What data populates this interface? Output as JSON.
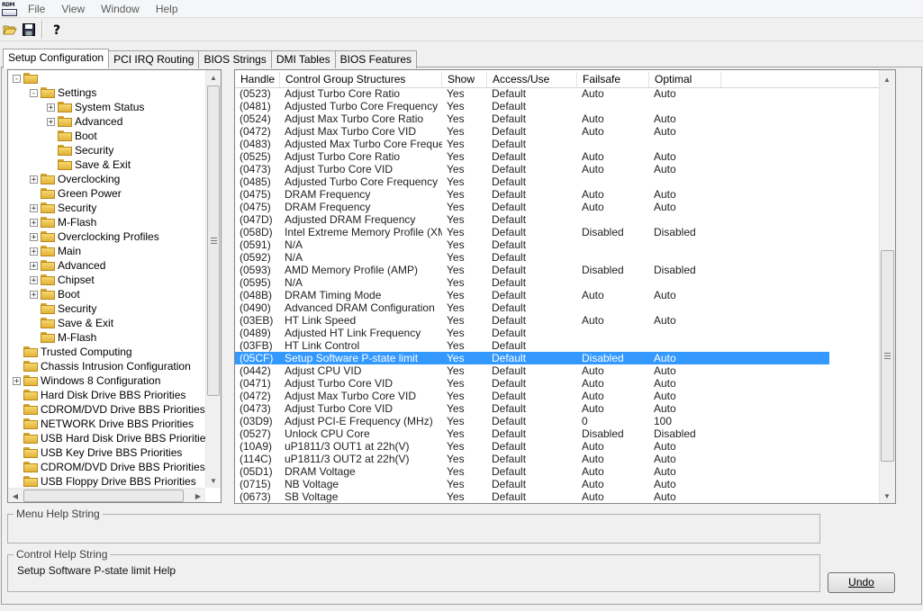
{
  "menu": [
    "File",
    "View",
    "Window",
    "Help"
  ],
  "toolbar": {
    "icons": [
      "open-folder-icon",
      "save-disk-icon",
      "help-question-icon"
    ]
  },
  "tabs": [
    "Setup Configuration",
    "PCI IRQ Routing",
    "BIOS Strings",
    "DMI Tables",
    "BIOS Features"
  ],
  "active_tab": 0,
  "tree": [
    {
      "label": "",
      "level": 0,
      "exp": "-"
    },
    {
      "label": "Settings",
      "level": 1,
      "exp": "-"
    },
    {
      "label": "System Status",
      "level": 2,
      "exp": "+"
    },
    {
      "label": "Advanced",
      "level": 2,
      "exp": "+"
    },
    {
      "label": "Boot",
      "level": 2,
      "exp": ""
    },
    {
      "label": "Security",
      "level": 2,
      "exp": ""
    },
    {
      "label": "Save & Exit",
      "level": 2,
      "exp": ""
    },
    {
      "label": "Overclocking",
      "level": 1,
      "exp": "+"
    },
    {
      "label": "Green Power",
      "level": 1,
      "exp": ""
    },
    {
      "label": "Security",
      "level": 1,
      "exp": "+"
    },
    {
      "label": "M-Flash",
      "level": 1,
      "exp": "+"
    },
    {
      "label": "Overclocking Profiles",
      "level": 1,
      "exp": "+"
    },
    {
      "label": "Main",
      "level": 1,
      "exp": "+"
    },
    {
      "label": "Advanced",
      "level": 1,
      "exp": "+"
    },
    {
      "label": "Chipset",
      "level": 1,
      "exp": "+"
    },
    {
      "label": "Boot",
      "level": 1,
      "exp": "+"
    },
    {
      "label": "Security",
      "level": 1,
      "exp": ""
    },
    {
      "label": "Save & Exit",
      "level": 1,
      "exp": ""
    },
    {
      "label": "M-Flash",
      "level": 1,
      "exp": ""
    },
    {
      "label": "Trusted Computing",
      "level": 0,
      "exp": ""
    },
    {
      "label": "Chassis Intrusion Configuration",
      "level": 0,
      "exp": ""
    },
    {
      "label": "Windows 8 Configuration",
      "level": 0,
      "exp": "+"
    },
    {
      "label": "Hard Disk Drive BBS Priorities",
      "level": 0,
      "exp": ""
    },
    {
      "label": "CDROM/DVD Drive BBS Priorities",
      "level": 0,
      "exp": ""
    },
    {
      "label": "NETWORK Drive BBS Priorities",
      "level": 0,
      "exp": ""
    },
    {
      "label": "USB Hard Disk Drive BBS Priorities",
      "level": 0,
      "exp": ""
    },
    {
      "label": "USB Key Drive BBS Priorities",
      "level": 0,
      "exp": ""
    },
    {
      "label": "CDROM/DVD Drive BBS Priorities",
      "level": 0,
      "exp": ""
    },
    {
      "label": "USB Floppy Drive BBS Priorities",
      "level": 0,
      "exp": ""
    }
  ],
  "grid": {
    "columns": [
      "Handle",
      "Control Group Structures",
      "Show",
      "Access/Use",
      "Failsafe",
      "Optimal"
    ],
    "selected_row": 21,
    "rows": [
      [
        "(0523)",
        "Adjust Turbo Core Ratio",
        "Yes",
        "Default",
        "Auto",
        "Auto"
      ],
      [
        "(0481)",
        "Adjusted Turbo Core Frequency",
        "Yes",
        "Default",
        "",
        ""
      ],
      [
        "(0524)",
        "Adjust Max Turbo Core Ratio",
        "Yes",
        "Default",
        "Auto",
        "Auto"
      ],
      [
        "(0472)",
        "Adjust Max Turbo Core VID",
        "Yes",
        "Default",
        "Auto",
        "Auto"
      ],
      [
        "(0483)",
        "Adjusted Max Turbo Core Freque...",
        "Yes",
        "Default",
        "",
        ""
      ],
      [
        "(0525)",
        "Adjust Turbo Core Ratio",
        "Yes",
        "Default",
        "Auto",
        "Auto"
      ],
      [
        "(0473)",
        "Adjust Turbo Core VID",
        "Yes",
        "Default",
        "Auto",
        "Auto"
      ],
      [
        "(0485)",
        "Adjusted Turbo Core Frequency",
        "Yes",
        "Default",
        "",
        ""
      ],
      [
        "(0475)",
        "DRAM Frequency",
        "Yes",
        "Default",
        "Auto",
        "Auto"
      ],
      [
        "(0475)",
        "DRAM Frequency",
        "Yes",
        "Default",
        "Auto",
        "Auto"
      ],
      [
        "(047D)",
        "Adjusted DRAM Frequency",
        "Yes",
        "Default",
        "",
        ""
      ],
      [
        "(058D)",
        "Intel Extreme Memory Profile (XMP)",
        "Yes",
        "Default",
        "Disabled",
        "Disabled"
      ],
      [
        "(0591)",
        "N/A",
        "Yes",
        "Default",
        "",
        ""
      ],
      [
        "(0592)",
        "N/A",
        "Yes",
        "Default",
        "",
        ""
      ],
      [
        "(0593)",
        "AMD Memory Profile (AMP)",
        "Yes",
        "Default",
        "Disabled",
        "Disabled"
      ],
      [
        "(0595)",
        "N/A",
        "Yes",
        "Default",
        "",
        ""
      ],
      [
        "(048B)",
        "DRAM Timing Mode",
        "Yes",
        "Default",
        "Auto",
        "Auto"
      ],
      [
        "(0490)",
        "Advanced DRAM Configuration",
        "Yes",
        "Default",
        "",
        ""
      ],
      [
        "(03EB)",
        "HT Link Speed",
        "Yes",
        "Default",
        "Auto",
        "Auto"
      ],
      [
        "(0489)",
        "Adjusted HT Link Frequency",
        "Yes",
        "Default",
        "",
        ""
      ],
      [
        "(03FB)",
        "HT Link Control",
        "Yes",
        "Default",
        "",
        ""
      ],
      [
        "(05CF)",
        "Setup Software P-state limit",
        "Yes",
        "Default",
        "Disabled",
        "Auto"
      ],
      [
        "(0442)",
        "Adjust CPU VID",
        "Yes",
        "Default",
        "Auto",
        "Auto"
      ],
      [
        "(0471)",
        "Adjust Turbo Core VID",
        "Yes",
        "Default",
        "Auto",
        "Auto"
      ],
      [
        "(0472)",
        "Adjust Max Turbo Core VID",
        "Yes",
        "Default",
        "Auto",
        "Auto"
      ],
      [
        "(0473)",
        "Adjust Turbo Core VID",
        "Yes",
        "Default",
        "Auto",
        "Auto"
      ],
      [
        "(03D9)",
        "Adjust PCI-E Frequency (MHz)",
        "Yes",
        "Default",
        "0",
        "100"
      ],
      [
        "(0527)",
        "Unlock CPU Core",
        "Yes",
        "Default",
        "Disabled",
        "Disabled"
      ],
      [
        "(10A9)",
        "uP1811/3 OUT1 at 22h(V)",
        "Yes",
        "Default",
        "Auto",
        "Auto"
      ],
      [
        "(114C)",
        "uP1811/3 OUT2 at 22h(V)",
        "Yes",
        "Default",
        "Auto",
        "Auto"
      ],
      [
        "(05D1)",
        "DRAM Voltage",
        "Yes",
        "Default",
        "Auto",
        "Auto"
      ],
      [
        "(0715)",
        "NB Voltage",
        "Yes",
        "Default",
        "Auto",
        "Auto"
      ],
      [
        "(0673)",
        "SB Voltage",
        "Yes",
        "Default",
        "Auto",
        "Auto"
      ]
    ]
  },
  "menu_help": {
    "label": "Menu Help String",
    "text": ""
  },
  "control_help": {
    "label": "Control Help String",
    "text": "Setup Software P-state limit Help"
  },
  "undo": {
    "label": "Undo"
  },
  "colors": {
    "selection": "#3399ff",
    "folder": "#e2b23a"
  }
}
